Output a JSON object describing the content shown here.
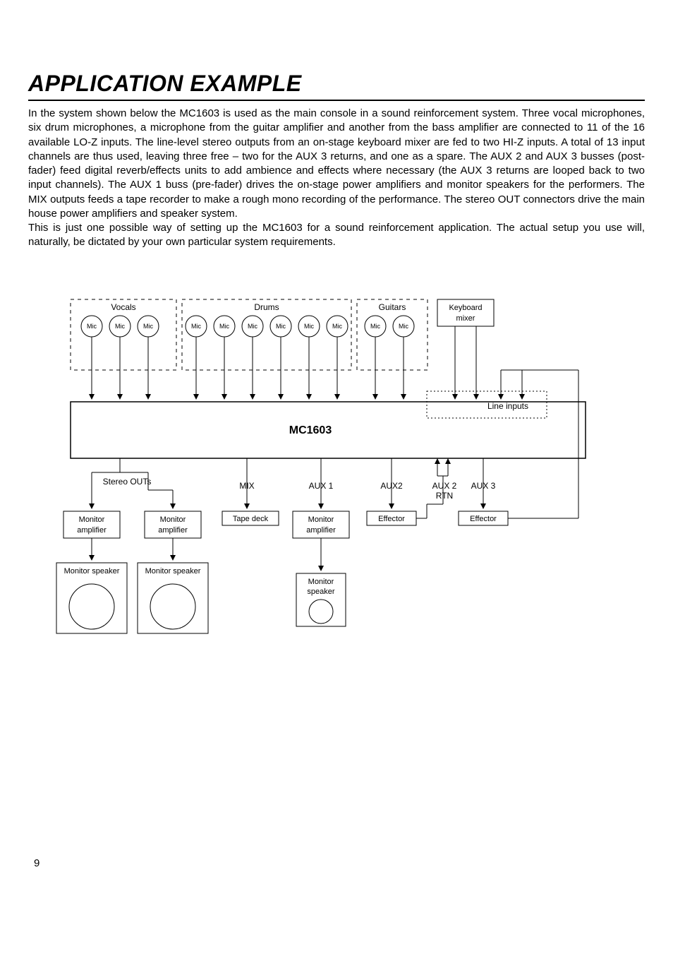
{
  "title": "APPLICATION EXAMPLE",
  "body": "In the system shown below the MC1603 is used as the main console in a sound reinforcement system. Three vocal microphones, six drum microphones, a microphone from the guitar amplifier and another from the bass amplifier are connected to 11 of the 16 available LO-Z inputs. The line-level stereo outputs from an on-stage keyboard mixer are fed to two HI-Z inputs. A total of 13 input channels are thus used, leaving three free – two for the AUX 3 returns, and one as a spare. The AUX 2 and AUX 3 busses (post-fader) feed digital reverb/effects units to add ambience and effects where necessary (the AUX 3 returns are looped back to two input channels). The AUX 1 buss (pre-fader) drives the on-stage power amplifiers and monitor speakers for the performers. The MIX outputs feeds a tape recorder to make a rough mono recording of the performance. The stereo OUT connectors drive the main house power amplifiers and speaker system.\nThis is just one possible way of setting up the MC1603 for a sound reinforcement application. The actual setup you use will, naturally, be dictated by your own particular system requirements.",
  "page_number": "9",
  "diagram": {
    "input_groups": {
      "vocals": {
        "label": "Vocals",
        "mics": [
          "Mic",
          "Mic",
          "Mic"
        ]
      },
      "drums": {
        "label": "Drums",
        "mics": [
          "Mic",
          "Mic",
          "Mic",
          "Mic",
          "Mic",
          "Mic"
        ]
      },
      "guitars": {
        "label": "Guitars",
        "mics": [
          "Mic",
          "Mic"
        ]
      },
      "keyboard": {
        "label1": "Keyboard",
        "label2": "mixer"
      }
    },
    "console": {
      "name": "MC1603",
      "line_inputs_label": "Line inputs"
    },
    "outputs": {
      "stereo_outs_label": "Stereo OUTs",
      "mix_label": "MIX",
      "aux1_label": "AUX 1",
      "aux2_label": "AUX2",
      "aux2_rtn_label": "AUX 2 RTN",
      "aux3_label": "AUX 3"
    },
    "devices": {
      "mon_amp_l1": "Monitor",
      "mon_amp_l2": "amplifier",
      "tape": "Tape deck",
      "effector": "Effector",
      "mon_spk_l1": "Monitor",
      "mon_spk_l2": "speaker"
    }
  }
}
